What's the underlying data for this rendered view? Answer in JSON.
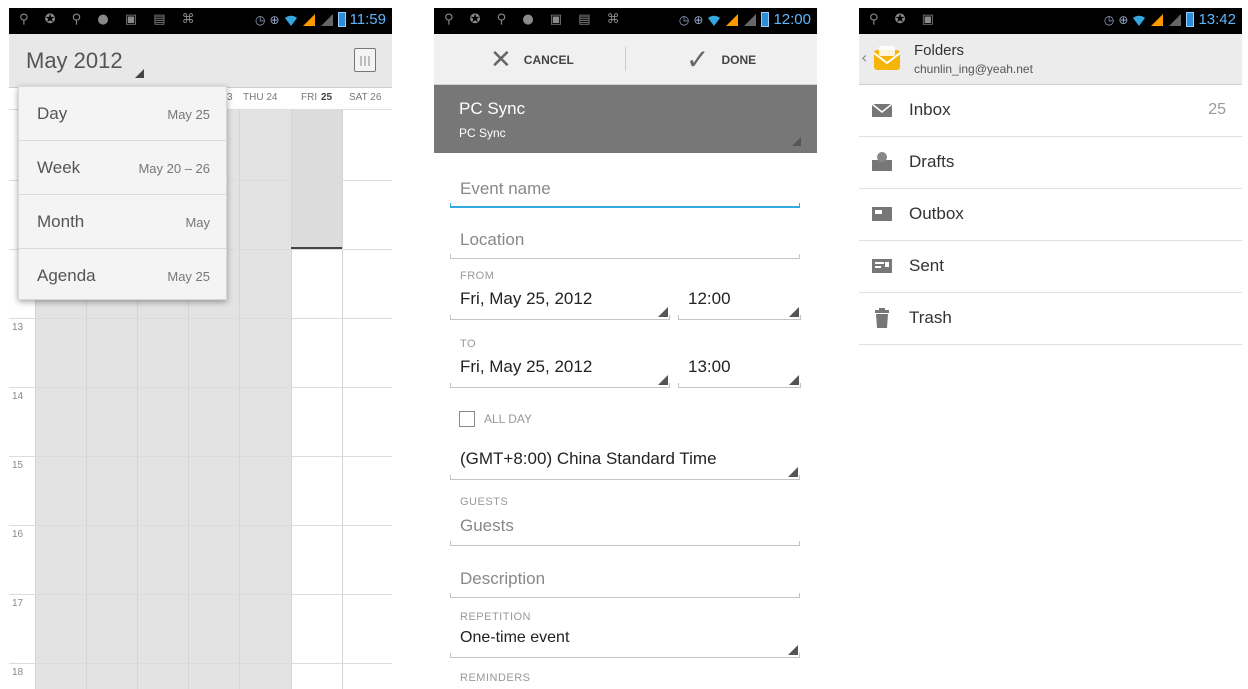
{
  "calendar": {
    "status_time": "11:59",
    "title": "May 2012",
    "day_headers": [
      "3",
      "THU 24",
      "FRI",
      "25",
      "SAT 26"
    ],
    "hours": [
      "13",
      "14",
      "15",
      "16",
      "17",
      "18"
    ],
    "view_menu": [
      {
        "label": "Day",
        "sub": "May 25"
      },
      {
        "label": "Week",
        "sub": "May 20 – 26"
      },
      {
        "label": "Month",
        "sub": "May"
      },
      {
        "label": "Agenda",
        "sub": "May 25"
      }
    ]
  },
  "event_form": {
    "status_time": "12:00",
    "cancel_label": "CANCEL",
    "done_label": "DONE",
    "account_name": "PC Sync",
    "account_sub": "PC Sync",
    "event_name_placeholder": "Event name",
    "location_placeholder": "Location",
    "from_label": "FROM",
    "from_date": "Fri, May 25, 2012",
    "from_time": "12:00",
    "to_label": "TO",
    "to_date": "Fri, May 25, 2012",
    "to_time": "13:00",
    "all_day_label": "ALL DAY",
    "timezone": "(GMT+8:00) China Standard Time",
    "guests_label": "GUESTS",
    "guests_placeholder": "Guests",
    "description_placeholder": "Description",
    "repetition_label": "REPETITION",
    "repetition_value": "One-time event",
    "reminders_label": "REMINDERS"
  },
  "folders": {
    "status_time": "13:42",
    "title": "Folders",
    "account": "chunlin_ing@yeah.net",
    "items": [
      {
        "label": "Inbox",
        "count": "25",
        "icon": "inbox-icon"
      },
      {
        "label": "Drafts",
        "count": "",
        "icon": "drafts-icon"
      },
      {
        "label": "Outbox",
        "count": "",
        "icon": "outbox-icon"
      },
      {
        "label": "Sent",
        "count": "",
        "icon": "sent-icon"
      },
      {
        "label": "Trash",
        "count": "",
        "icon": "trash-icon"
      }
    ]
  },
  "colors": {
    "status_time": "#5fb6ff",
    "accent_blue": "#33a7e0",
    "account_bar": "#777777"
  }
}
